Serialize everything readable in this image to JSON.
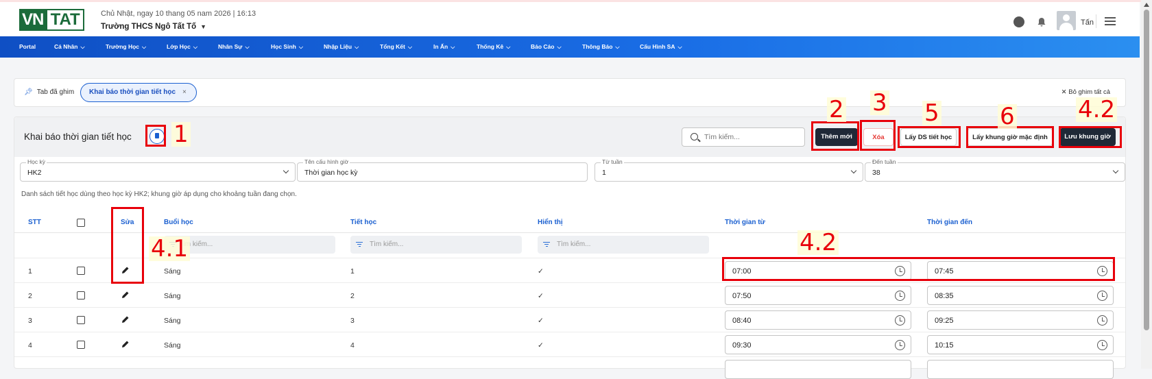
{
  "header": {
    "logo_part1": "VN",
    "logo_part2": "TAT",
    "datetime": "Chủ Nhật, ngay 10 thang 05 nam 2026 | 16:13",
    "school": "Trường THCS Ngô Tất Tố",
    "username": "Tấn"
  },
  "nav": {
    "items": [
      "Portal",
      "Cá Nhân",
      "Trường Học",
      "Lớp Học",
      "Nhân Sự",
      "Học Sinh",
      "Nhập Liệu",
      "Tổng Kết",
      "In Ấn",
      "Thống Kê",
      "Báo Cáo",
      "Thông Báo",
      "Cấu Hình SA"
    ]
  },
  "pinbar": {
    "label": "Tab đã ghim",
    "tab": "Khai báo thời gian tiết học",
    "close": "×",
    "unpin_all": "Bỏ ghim tất cả"
  },
  "card": {
    "title": "Khai báo thời gian tiết học",
    "search_placeholder": "Tìm kiếm...",
    "buttons": {
      "add": "Thêm mới",
      "delete": "Xóa",
      "get_periods": "Lấy DS tiết học",
      "get_default": "Lấy khung giờ mặc định",
      "save": "Lưu khung giờ"
    },
    "fields": {
      "semester_label": "Học kỳ",
      "semester_value": "HK2",
      "config_label": "Tên cấu hình giờ",
      "config_value": "Thời gian học kỳ",
      "from_week_label": "Từ tuần",
      "from_week_value": "1",
      "to_week_label": "Đến tuần",
      "to_week_value": "38"
    },
    "note": "Danh sách tiết học dùng theo học kỳ HK2; khung giờ áp dụng cho khoảng tuần đang chọn.",
    "columns": [
      "STT",
      "Sửa",
      "Buổi học",
      "Tiết học",
      "Hiển thị",
      "Thời gian từ",
      "Thời gian đến"
    ],
    "filter_placeholder": "Tìm kiếm...",
    "filter_partial": "ìm kiếm...",
    "rows": [
      {
        "stt": "1",
        "session": "Sáng",
        "period": "1",
        "visible": "✓",
        "from": "07:00",
        "to": "07:45"
      },
      {
        "stt": "2",
        "session": "Sáng",
        "period": "2",
        "visible": "✓",
        "from": "07:50",
        "to": "08:35"
      },
      {
        "stt": "3",
        "session": "Sáng",
        "period": "3",
        "visible": "✓",
        "from": "08:40",
        "to": "09:25"
      },
      {
        "stt": "4",
        "session": "Sáng",
        "period": "4",
        "visible": "✓",
        "from": "09:30",
        "to": "10:15"
      }
    ]
  },
  "annotations": {
    "a1": "1",
    "a2": "2",
    "a3": "3",
    "a5": "5",
    "a6": "6",
    "a42_top": "4.2",
    "a41": "4.1",
    "a42_row": "4.2"
  },
  "colors": {
    "nav_start": "#0f4fc4",
    "nav_end": "#2b8ff0",
    "accent": "#1a5fd0",
    "annotation_red": "#e8000a",
    "dark_button": "#1f2937"
  },
  "icons": [
    "chat-icon",
    "bell-icon",
    "avatar",
    "menu-icon",
    "pin-icon",
    "search-icon",
    "pencil-icon",
    "clock-icon",
    "chevron-down-icon",
    "filter-icon"
  ]
}
